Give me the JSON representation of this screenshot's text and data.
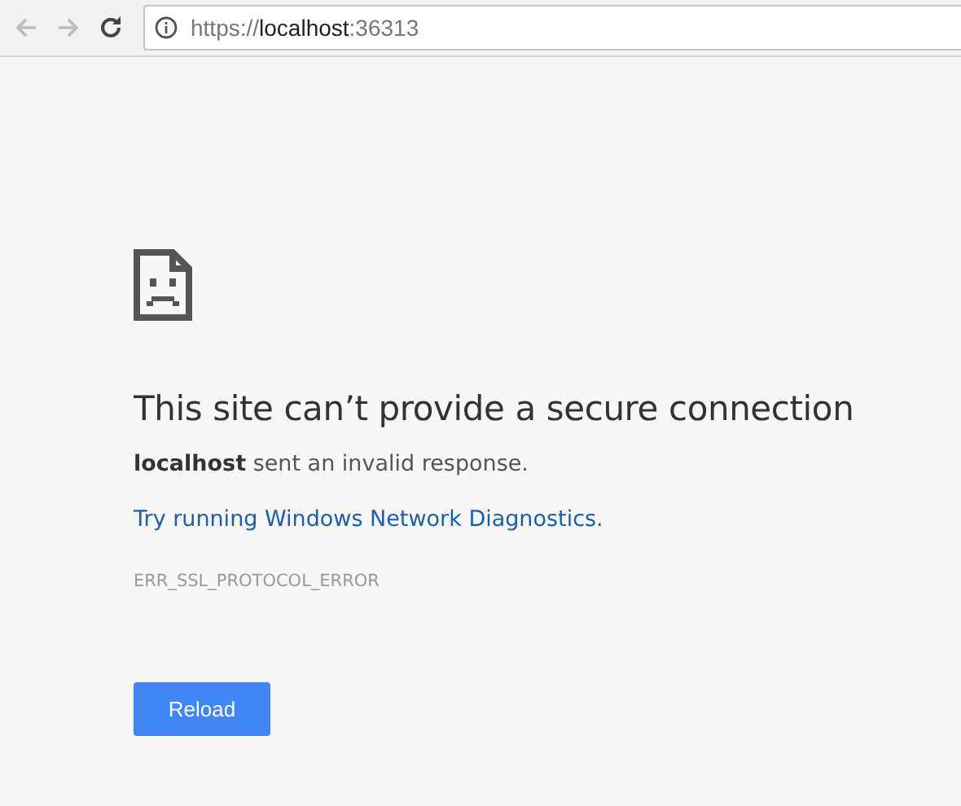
{
  "toolbar": {
    "back": {
      "disabled": true
    },
    "forward": {
      "disabled": true
    },
    "address": {
      "scheme": "https://",
      "host": "localhost",
      "port": ":36313"
    }
  },
  "error": {
    "title": "This site can’t provide a secure connection",
    "message": "**localhost** sent an invalid response.",
    "link": "Try running Windows Network Diagnostics.",
    "code": "ERR_SSL_PROTOCOL_ERROR",
    "button": "Reload"
  }
}
